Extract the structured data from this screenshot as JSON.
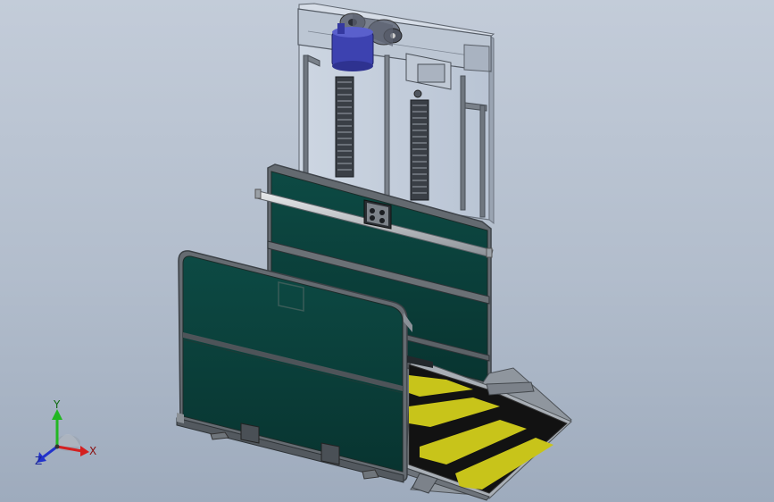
{
  "viewport": {
    "background_top": "#c3ccd9",
    "background_bottom": "#9eabbd"
  },
  "model": {
    "panel_color": "#0a3b36",
    "frame_color": "#6f7478",
    "glass_color": "#c9d2de",
    "motor_color": "#3a3fa8",
    "stripe_yellow": "#c8c41a",
    "stripe_black": "#111111"
  },
  "triad": {
    "x_label": "X",
    "y_label": "Y",
    "z_label": "Z",
    "x_color": "#d42020",
    "y_color": "#22b722",
    "z_color": "#2233cc"
  }
}
